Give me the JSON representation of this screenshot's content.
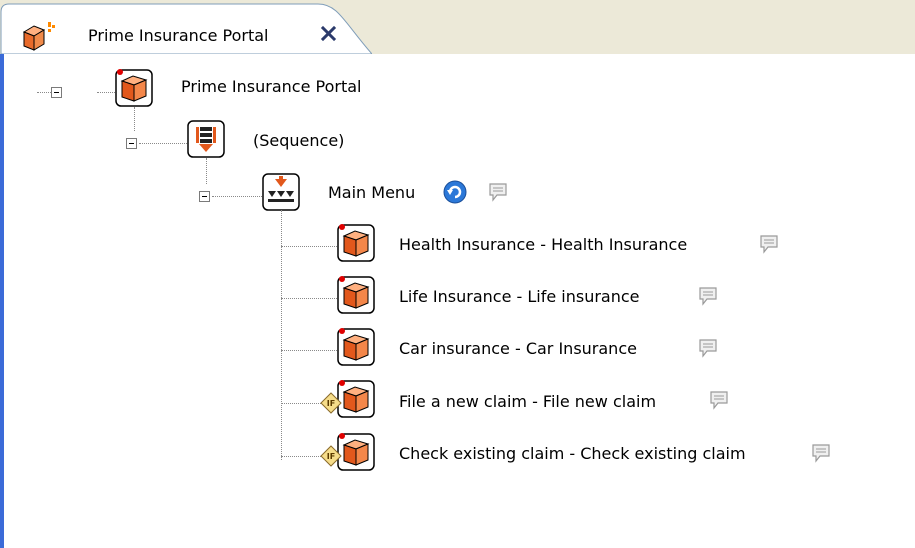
{
  "tab": {
    "title": "Prime Insurance Portal",
    "close_icon": "close-icon",
    "colors": {
      "accent": "#3b6bd8",
      "tab_bg": "#ece9d8"
    }
  },
  "tree": {
    "root": {
      "label": "Prime Insurance Portal",
      "icon": "cube-icon"
    },
    "sequence": {
      "label": "(Sequence)",
      "icon": "sequence-icon"
    },
    "menu": {
      "label": "Main Menu",
      "icon": "menu-icon",
      "loop_icon": "loop-icon",
      "comment_icon": "comment-icon"
    },
    "items": [
      {
        "label": "Health Insurance - Health Insurance",
        "icon": "cube-icon",
        "conditional": false
      },
      {
        "label": "Life Insurance - Life insurance",
        "icon": "cube-icon",
        "conditional": false
      },
      {
        "label": "Car insurance - Car Insurance",
        "icon": "cube-icon",
        "conditional": false
      },
      {
        "label": "File a new claim - File new claim",
        "icon": "conditional-cube-icon",
        "conditional": true
      },
      {
        "label": "Check existing claim - Check existing claim",
        "icon": "conditional-cube-icon",
        "conditional": true
      }
    ]
  }
}
